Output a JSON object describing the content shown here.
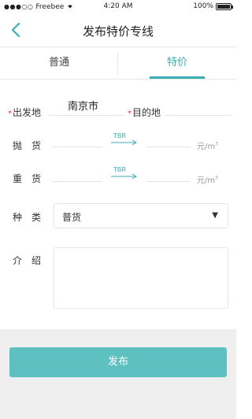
{
  "status_bar": {
    "signal_dots": "●●●○○",
    "carrier": "Freebee",
    "time": "4:20 AM",
    "battery": "100%",
    "battery_level": 1.0
  },
  "nav": {
    "title": "发布特价专线"
  },
  "tabs": [
    {
      "label": "普通",
      "active": false
    },
    {
      "label": "特价",
      "active": true
    }
  ],
  "form": {
    "origin_label": "出发地",
    "origin_value": "南京市",
    "dest_label": "目的地",
    "required_mark": "*",
    "light_goods_label": "抛　货",
    "heavy_goods_label": "重　货",
    "arrow_text": "TBR",
    "unit_prefix": "元/m",
    "unit_sup": "3",
    "type_label": "种　类",
    "type_value": "普货",
    "caret": "▼",
    "intro_label": "介　绍"
  },
  "actions": {
    "submit_label": "发布"
  },
  "colors": {
    "accent": "#3aaeb4",
    "button": "#5fc0c2",
    "required": "#e23b3b"
  }
}
